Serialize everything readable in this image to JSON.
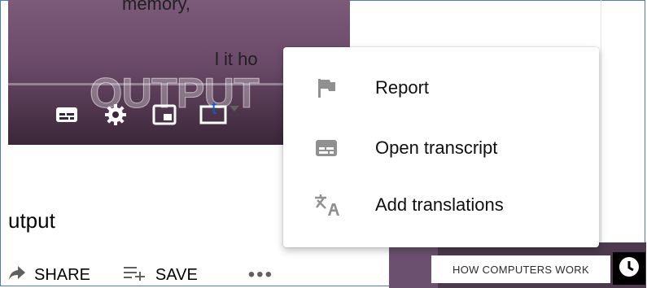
{
  "player": {
    "overlay_text": "OUTPUT",
    "controls": [
      {
        "icon": "subtitles-icon"
      },
      {
        "icon": "settings-gear-icon"
      },
      {
        "icon": "miniplayer-icon"
      },
      {
        "icon": "theater-mode-icon"
      }
    ]
  },
  "video": {
    "title_partial": "utput"
  },
  "actions": {
    "share_label": "SHARE",
    "save_label": "SAVE",
    "more_label": "•••"
  },
  "sidebar": {
    "text_top": "memory,",
    "text_mid": "l it ho",
    "link_partial": "t"
  },
  "thumbnail": {
    "label": "HOW COMPUTERS WORK"
  },
  "menu": {
    "items": [
      {
        "label": "Report",
        "icon": "flag-icon"
      },
      {
        "label": "Open transcript",
        "icon": "transcript-icon"
      },
      {
        "label": "Add translations",
        "icon": "translate-icon"
      }
    ]
  },
  "colors": {
    "menu_text": "#0f0f0f",
    "menu_icon": "#909090",
    "link_blue": "#065fd4",
    "player_purple": "#6a4a68",
    "frame_border": "#4a7bc8"
  }
}
